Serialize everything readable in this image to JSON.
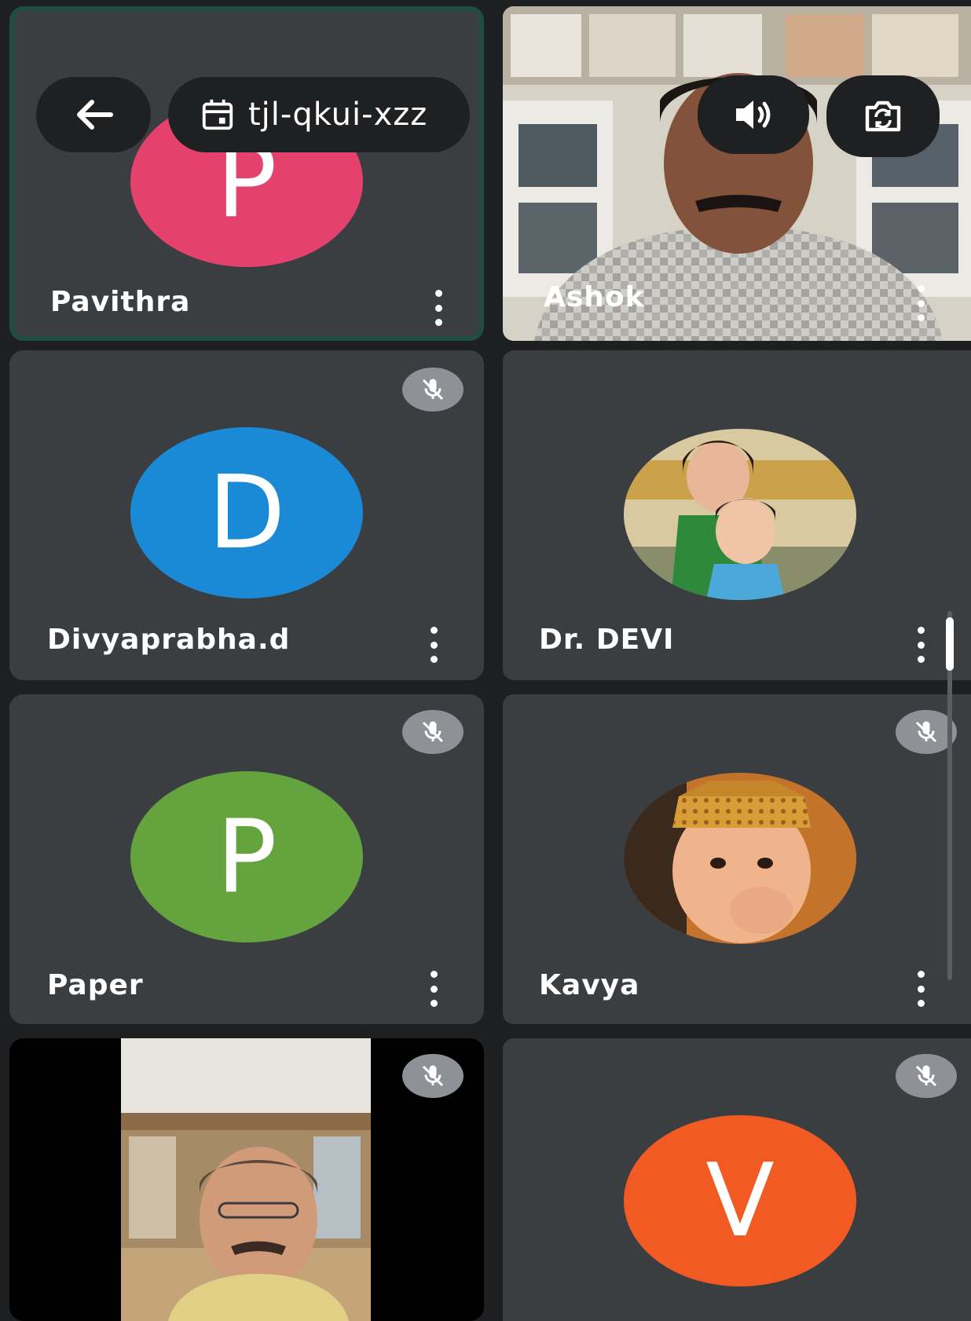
{
  "meeting": {
    "code": "tjl-qkui-xzz"
  },
  "toolbar": {
    "back_icon": "arrow-left-icon",
    "meeting_icon": "calendar-icon",
    "speaker_icon": "speaker-icon",
    "switch_camera_icon": "switch-camera-icon"
  },
  "participants": [
    {
      "name": "Pavithra",
      "initial": "P",
      "color": "#e4416d",
      "video": false,
      "muted": false,
      "active": true
    },
    {
      "name": "Ashok",
      "initial": "",
      "color": "",
      "video": true,
      "muted": false,
      "active": false
    },
    {
      "name": "Divyaprabha.d",
      "initial": "D",
      "color": "#1a8ad6",
      "video": false,
      "muted": true,
      "active": false
    },
    {
      "name": "Dr. DEVI",
      "initial": "",
      "color": "",
      "video": false,
      "profile_photo": true,
      "muted": false,
      "active": false
    },
    {
      "name": "Paper",
      "initial": "P",
      "color": "#64a33e",
      "video": false,
      "muted": true,
      "active": false
    },
    {
      "name": "Kavya",
      "initial": "",
      "color": "",
      "video": false,
      "profile_photo": true,
      "muted": true,
      "active": false
    },
    {
      "name": "",
      "initial": "",
      "color": "",
      "video": true,
      "muted": true,
      "active": false
    },
    {
      "name": "",
      "initial": "V",
      "color": "#f15a22",
      "video": false,
      "muted": true,
      "active": false
    }
  ]
}
